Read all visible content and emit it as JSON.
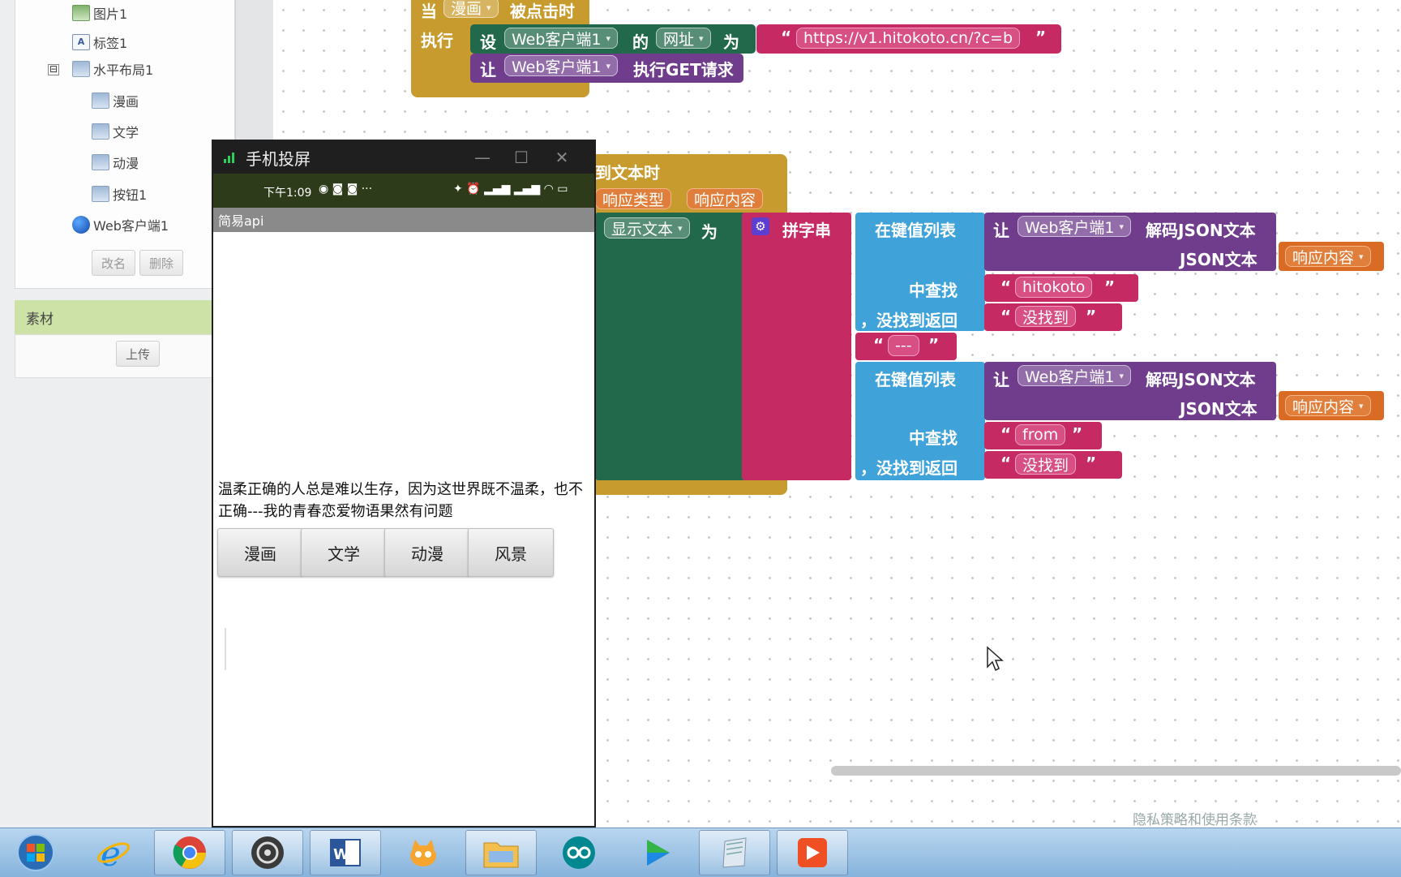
{
  "tree": {
    "items": [
      {
        "label": "图片1",
        "icon": "image-icon"
      },
      {
        "label": "标签1",
        "icon": "label-icon"
      },
      {
        "label": "水平布局1",
        "icon": "layout-icon"
      },
      {
        "label": "漫画",
        "icon": "button-icon"
      },
      {
        "label": "文学",
        "icon": "button-icon"
      },
      {
        "label": "动漫",
        "icon": "button-icon"
      },
      {
        "label": "按钮1",
        "icon": "button-icon"
      },
      {
        "label": "Web客户端1",
        "icon": "globe-icon"
      }
    ],
    "collapse_glyph": "⊟",
    "rename_label": "改名",
    "delete_label": "删除"
  },
  "assets": {
    "header": "素材",
    "upload_label": "上传"
  },
  "blocks": {
    "click_event": {
      "when": "当",
      "component": "漫画",
      "event": "被点击时",
      "do": "执行",
      "set": "设",
      "set_component": "Web客户端1",
      "of": "的",
      "property": "网址",
      "to": "为",
      "url": "https://v1.hitokoto.cn/?c=b",
      "call": "让",
      "call_component": "Web客户端1",
      "method": "执行GET请求"
    },
    "got_text_event": {
      "title": "到文本时",
      "param1": "响应类型",
      "param2": "响应内容",
      "set_target": "显示文本",
      "to": "为",
      "join": "拼字串",
      "lookup1": {
        "in_pairs": "在键值列表",
        "call": "让",
        "component": "Web客户端1",
        "method": "解码JSON文本",
        "json_text": "JSON文本",
        "response": "响应内容",
        "find": "中查找",
        "key": "hitokoto",
        "not_found": "，没找到返回",
        "not_found_value": "没找到"
      },
      "separator": "---",
      "lookup2": {
        "in_pairs": "在键值列表",
        "call": "让",
        "component": "Web客户端1",
        "method": "解码JSON文本",
        "json_text": "JSON文本",
        "response": "响应内容",
        "find": "中查找",
        "key": "from",
        "not_found": "，没找到返回",
        "not_found_value": "没找到"
      }
    }
  },
  "phone": {
    "window_title": "手机投屏",
    "status_time": "下午1:09",
    "app_title": "简易api",
    "quote": "温柔正确的人总是难以生存，因为这世界既不温柔，也不正确---我的青春恋爱物语果然有问题",
    "buttons": [
      "漫画",
      "文学",
      "动漫",
      "风景"
    ]
  },
  "footer": {
    "privacy": "隐私策略和使用条款"
  },
  "taskbar": {
    "items": [
      "start-orb-icon",
      "ie-icon",
      "chrome-icon",
      "app-inventor-icon",
      "word-icon",
      "scratch-icon",
      "folder-icon",
      "arduino-icon",
      "media-player-icon",
      "notepad-icon",
      "video-recorder-icon"
    ]
  },
  "colors": {
    "event_block": "#c89b2e",
    "set_block": "#21694a",
    "method_block": "#6f3d8c",
    "text_block": "#c62a63",
    "dictionary_block": "#3fa2d9",
    "param_pill": "#e07f3b"
  }
}
